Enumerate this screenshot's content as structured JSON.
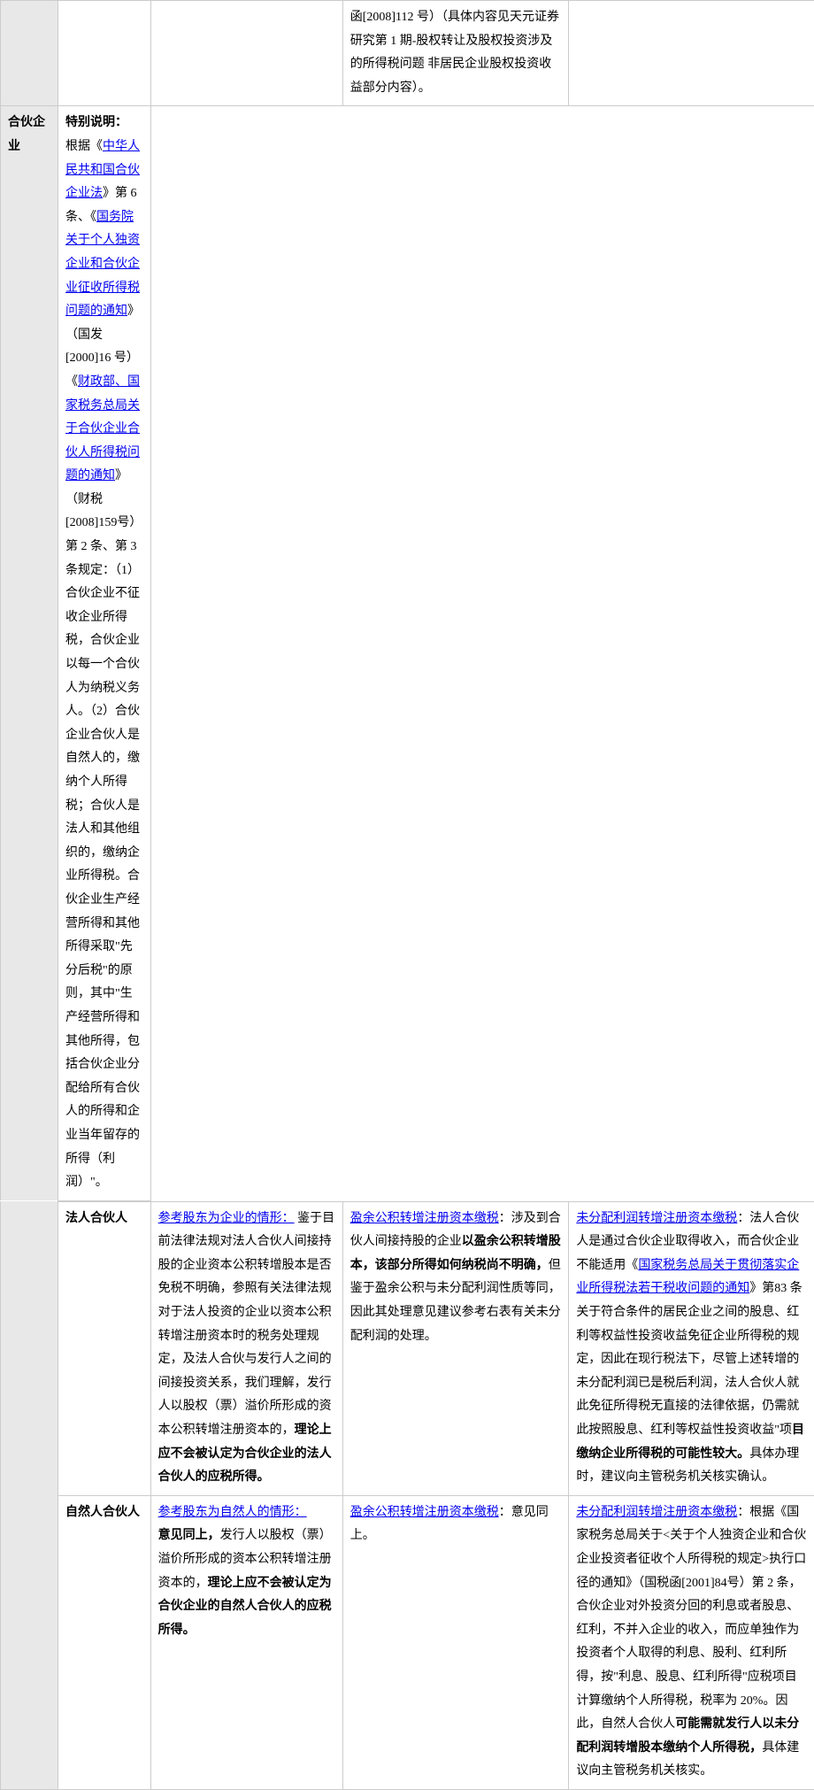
{
  "row0": {
    "c2": "函[2008]112 号）（具体内容见天元证券研究第 1 期-股权转让及股权投资涉及的所得税问题 非居民企业股权投资收益部分内容）。"
  },
  "row1": {
    "side": "合伙企业",
    "special_label": "特别说明：",
    "special_text_a": "根据《",
    "special_link_a": "中华人民共和国合伙企业法",
    "special_text_b": "》第 6 条、《",
    "special_link_b": "国务院关于个人独资企业和合伙企业征收所得税问题的通知",
    "special_text_c": "》（国发[2000]16 号）《",
    "special_link_c": "财政部、国家税务总局关于合伙企业合伙人所得税问题的通知",
    "special_text_d": "》（财税[2008]159号）第 2 条、第 3 条规定：（1）合伙企业不征收企业所得税，合伙企业以每一个合伙人为纳税义务人。（2）合伙企业合伙人是自然人的，缴纳个人所得税；合伙人是法人和其他组织的，缴纳企业所得税。合伙企业生产经营所得和其他所得采取\"先分后税\"的原则，其中\"生产经营所得和其他所得，包括合伙企业分配给所有合伙人的所得和企业当年留存的所得（利润）\"。"
  },
  "row2": {
    "sub": "法人合伙人",
    "c1_link": "参考股东为企业的情形：",
    "c1_text": "鉴于目前法律法规对法人合伙人间接持股的企业资本公积转增股本是否免税不明确，参照有关法律法规对于法人投资的企业以资本公积转增注册资本时的税务处理规定，及法人合伙与发行人之间的间接投资关系，我们理解，发行人以股权（票）溢价所形成的资本公积转增注册资本的，",
    "c1_bold": "理论上应不会被认定为合伙企业的法人合伙人的应税所得。",
    "c2_link": "盈余公积转增注册资本缴税",
    "c2_text_a": "：涉及到合伙人间接持股的企业",
    "c2_bold": "以盈余公积转增股本，该部分所得如何纳税尚不明确，",
    "c2_text_b": "但鉴于盈余公积与未分配利润性质等同，因此其处理意见建议参考右表有关未分配利润的处理。",
    "c3_link_a": "未分配利润转增注册资本缴税",
    "c3_text_a": "：法人合伙人是通过合伙企业取得收入，而合伙企业不能适用《",
    "c3_link_b": "国家税务总局关于贯彻落实企业所得税法若干税收问题的通知",
    "c3_text_b": "》第83 条关于符合条件的居民企业之间的股息、红利等权益性投资收益免征企业所得税的规定，因此在现行税法下，尽管上述转增的未分配利润已是税后利润，法人合伙人就此免征所得税无直接的法律依据，仍需就此按照股息、红利等权益性投资收益\"项",
    "c3_bold": "目缴纳企业所得税的可能性较大。",
    "c3_text_c": "具体办理时，建议向主管税务机关核实确认。"
  },
  "row3": {
    "sub": "自然人合伙人",
    "c1_link": "参考股东为自然人的情形：",
    "c1_bold_a": "意见同上，",
    "c1_text": "发行人以股权（票）溢价所形成的资本公积转增注册资本的，",
    "c1_bold_b": "理论上应不会被认定为合伙企业的自然人合伙人的应税所得。",
    "c2_link": "盈余公积转增注册资本缴税",
    "c2_text": "：意见同上。",
    "c3_link": "未分配利润转增注册资本缴税",
    "c3_text_a": "：根据《国家税务总局关于<关于个人独资企业和合伙企业投资者征收个人所得税的规定>执行口径的通知》（国税函[2001]84号）第 2 条，合伙企业对外投资分回的利息或者股息、红利，不并入企业的收入，而应单独作为投资者个人取得的利息、股利、红利所得，按\"利息、股息、红利所得\"应税项目计算缴纳个人所得税，税率为 20%。因此，自然人合伙人",
    "c3_bold": "可能需就发行人以未分配利润转增股本缴纳个人所得税，",
    "c3_text_b": "具体建议向主管税务机关核实。"
  }
}
